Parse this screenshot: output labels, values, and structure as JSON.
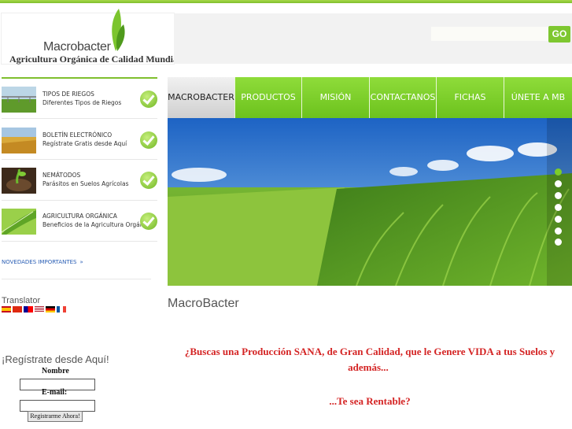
{
  "header": {
    "brand": "Macrobacter",
    "tagline": "Agricultura Orgánica de Calidad Mundial",
    "search_placeholder": "",
    "go_label": "GO"
  },
  "sidebar": {
    "items": [
      {
        "title": "TIPOS DE RIEGOS",
        "subtitle": "Diferentes Tipos de Riegos"
      },
      {
        "title": "BOLETÍN ELECTRÓNICO",
        "subtitle": "Regístrate Gratis desde Aquí"
      },
      {
        "title": "NEMÁTODOS",
        "subtitle": "Parásitos en Suelos Agrícolas"
      },
      {
        "title": "AGRICULTURA ORGÁNICA",
        "subtitle": "Beneficios de la Agricultura Orgánica"
      }
    ],
    "news_link": "NOVEDADES IMPORTANTES",
    "translator_label": "Translator"
  },
  "registration": {
    "title": "¡Regístrate desde Aquí!",
    "name_label": "Nombre",
    "email_label": "E-mail:",
    "submit_label": "Registrarme Ahora!"
  },
  "nav": {
    "items": [
      "MACROBACTER",
      "PRODUCTOS",
      "MISIÓN",
      "CONTACTANOS",
      "FICHAS",
      "ÚNETE A MB"
    ],
    "active": "MACROBACTER"
  },
  "slider": {
    "slides": 7,
    "active": 1
  },
  "content": {
    "heading": "MacroBacter",
    "line1": "¿Buscas una Producción SANA, de Gran Calidad, que le Genere VIDA a tus Suelos y",
    "line2": "además...",
    "line3": "...Te sea Rentable?"
  },
  "colors": {
    "accent": "#7ec730",
    "message": "#d42424",
    "link": "#2b5fb5"
  }
}
